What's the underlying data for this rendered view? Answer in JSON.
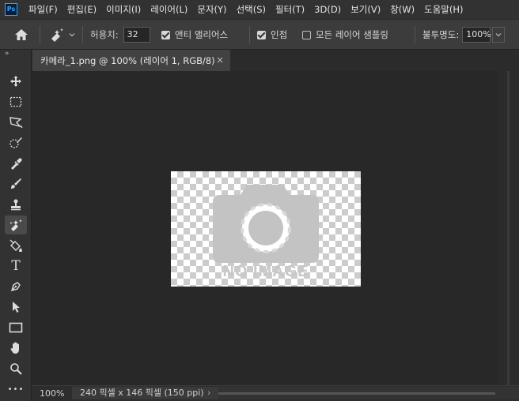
{
  "app": {
    "logo_text": "Ps"
  },
  "menu": [
    "파일(F)",
    "편집(E)",
    "이미지(I)",
    "레이어(L)",
    "문자(Y)",
    "선택(S)",
    "필터(T)",
    "3D(D)",
    "보기(V)",
    "창(W)",
    "도움말(H)"
  ],
  "options": {
    "tolerance_label": "허용치:",
    "tolerance_value": "32",
    "antialias_label": "앤티 앨리어스",
    "antialias_checked": true,
    "contiguous_label": "인접",
    "contiguous_checked": true,
    "sample_all_label": "모든 레이어 샘플링",
    "sample_all_checked": false,
    "opacity_label": "불투명도:",
    "opacity_value": "100%"
  },
  "toolbar": {
    "collapse_glyph": "»",
    "tools": [
      {
        "name": "move-tool",
        "icon": "move-icon"
      },
      {
        "name": "marquee-tool",
        "icon": "rect-marquee-icon"
      },
      {
        "name": "lasso-tool",
        "icon": "polygon-lasso-icon"
      },
      {
        "name": "quick-select-tool",
        "icon": "quick-select-icon"
      },
      {
        "name": "eyedropper-tool",
        "icon": "eyedropper-icon"
      },
      {
        "name": "brush-tool",
        "icon": "brush-icon"
      },
      {
        "name": "stamp-tool",
        "icon": "clone-stamp-icon"
      },
      {
        "name": "magic-eraser-tool",
        "icon": "magic-eraser-icon",
        "active": true
      },
      {
        "name": "paint-bucket-tool",
        "icon": "paint-bucket-icon"
      },
      {
        "name": "type-tool",
        "icon": "type-icon",
        "glyph": "T"
      },
      {
        "name": "pen-tool",
        "icon": "pen-icon"
      },
      {
        "name": "path-select-tool",
        "icon": "arrow-icon"
      },
      {
        "name": "shape-tool",
        "icon": "rectangle-icon"
      },
      {
        "name": "hand-tool",
        "icon": "hand-icon"
      },
      {
        "name": "zoom-tool",
        "icon": "magnifier-icon"
      },
      {
        "name": "more-tools",
        "icon": "more-icon",
        "glyph": "•••"
      }
    ]
  },
  "document": {
    "tab_title": "카메라_1.png @ 100% (레이어 1, RGB/8)",
    "close_glyph": "×",
    "image_text": "NO IMAGE"
  },
  "status": {
    "zoom": "100%",
    "doc_info": "240 픽셀 x 146 픽셀 (150 ppi)",
    "arrow_glyph": "›"
  }
}
